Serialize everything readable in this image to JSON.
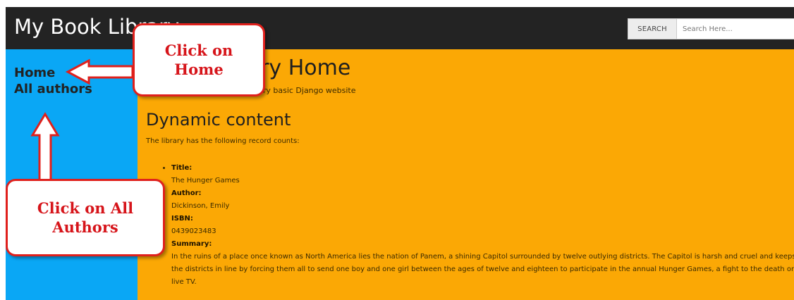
{
  "navbar": {
    "brand": "My Book Library",
    "search_button": "SEARCH",
    "search_placeholder": "Search Here..."
  },
  "sidebar": {
    "items": [
      {
        "label": "Home"
      },
      {
        "label": "All authors"
      }
    ]
  },
  "main": {
    "heading": "Local Library Home",
    "subtitle": "Welcome to LocalLibrary, a very basic Django website",
    "section_heading": "Dynamic content",
    "intro": "The library has the following record counts:",
    "book": {
      "title_label": "Title:",
      "title": "The Hunger Games",
      "author_label": "Author:",
      "author": "Dickinson, Emily",
      "isbn_label": "ISBN:",
      "isbn": "0439023483",
      "summary_label": "Summary:",
      "summary": "In the ruins of a place once known as North America lies the nation of Panem, a shining Capitol surrounded by twelve outlying districts. The Capitol is harsh and cruel and keeps the districts in line by forcing them all to send one boy and one girl between the ages of twelve and eighteen to participate in the annual Hunger Games, a fight to the death on live TV."
    }
  },
  "annotations": {
    "home_callout": "Click on Home",
    "authors_callout": "Click on All Authors"
  },
  "colors": {
    "navbar": "#232323",
    "sidebar": "#0aa7f5",
    "content": "#fba805",
    "callout_red": "#e0201c"
  }
}
